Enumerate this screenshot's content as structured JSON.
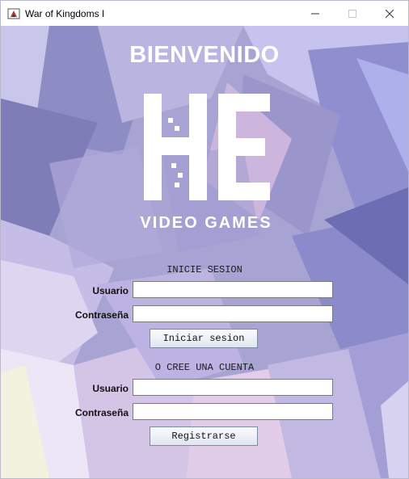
{
  "window": {
    "title": "War of Kingdoms I",
    "icon": "java-app-icon",
    "minimize_icon": "minimize-icon",
    "maximize_icon": "maximize-icon",
    "close_icon": "close-icon"
  },
  "main": {
    "heading": "BIENVENIDO",
    "logo": {
      "mark": "HE",
      "subtitle": "VIDEO GAMES"
    }
  },
  "login": {
    "section_title": "INICIE SESION",
    "username_label": "Usuario",
    "username_value": "",
    "password_label": "Contraseña",
    "password_value": "",
    "submit_label": "Iniciar sesion"
  },
  "register": {
    "section_title": "O CREE UNA CUENTA",
    "username_label": "Usuario",
    "username_value": "",
    "password_label": "Contraseña",
    "password_value": "",
    "submit_label": "Registrarse"
  },
  "colors": {
    "background": "#a9a6d6",
    "heading": "#ffffff",
    "logo": "#ffffff"
  }
}
